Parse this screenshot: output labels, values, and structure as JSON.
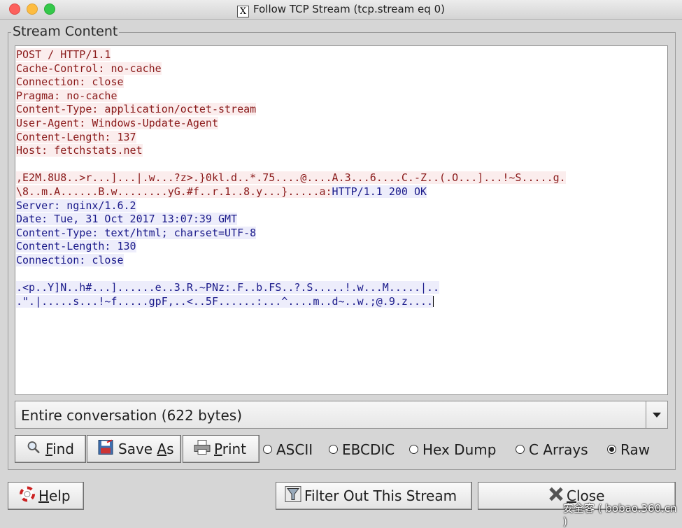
{
  "window": {
    "title": "Follow TCP Stream (tcp.stream eq 0)",
    "app_icon_glyph": "X"
  },
  "group": {
    "legend": "Stream Content"
  },
  "stream": {
    "lines": [
      {
        "text": "POST / HTTP/1.1",
        "side": "client"
      },
      {
        "text": "Cache-Control: no-cache",
        "side": "client"
      },
      {
        "text": "Connection: close",
        "side": "client"
      },
      {
        "text": "Pragma: no-cache",
        "side": "client"
      },
      {
        "text": "Content-Type: application/octet-stream",
        "side": "client"
      },
      {
        "text": "User-Agent: Windows-Update-Agent",
        "side": "client"
      },
      {
        "text": "Content-Length: 137",
        "side": "client"
      },
      {
        "text": "Host: fetchstats.net",
        "side": "client"
      },
      {
        "text": "",
        "side": "client"
      },
      {
        "text": ",E2M.8U8..>r...]...|.w...?z>.}0kl.d..*.75....@....A.3...6....C.-Z..(.O...]...!~S.....g.",
        "side": "client"
      },
      {
        "segments": [
          {
            "text": "\\8..m.A......B.w........yG.#f..r.1..8.y...}.....a:",
            "side": "client"
          },
          {
            "text": "HTTP/1.1 200 OK",
            "side": "server"
          }
        ]
      },
      {
        "text": "Server: nginx/1.6.2",
        "side": "server"
      },
      {
        "text": "Date: Tue, 31 Oct 2017 13:07:39 GMT",
        "side": "server"
      },
      {
        "text": "Content-Type: text/html; charset=UTF-8",
        "side": "server"
      },
      {
        "text": "Content-Length: 130",
        "side": "server"
      },
      {
        "text": "Connection: close",
        "side": "server"
      },
      {
        "text": "",
        "side": "server"
      },
      {
        "text": ".<p..Y]N..h#...]......e..3.R.~PNz:.F..b.FS..?.S.....!.w...M.....|..",
        "side": "server"
      },
      {
        "text": ".\".|.....s...!~f.....gpF,..<..5F......:...^....m..d~..w.;@.9.z....",
        "side": "server",
        "caret": true
      }
    ],
    "client_color": "#8a1a1a",
    "server_color": "#1a1a8a"
  },
  "conversation_select": {
    "selected": "Entire conversation (622 bytes)"
  },
  "actions": {
    "find": {
      "mnemonic": "F",
      "rest": "ind",
      "icon": "magnifier-icon"
    },
    "save_as": {
      "pre": "Save ",
      "mnemonic": "A",
      "rest": "s",
      "icon": "save-icon"
    },
    "print": {
      "mnemonic": "P",
      "rest": "rint",
      "icon": "printer-icon"
    }
  },
  "format": {
    "options": [
      "ASCII",
      "EBCDIC",
      "Hex Dump",
      "C Arrays",
      "Raw"
    ],
    "selected": "Raw"
  },
  "footer": {
    "help": {
      "mnemonic": "H",
      "rest": "elp",
      "icon": "lifebuoy-icon"
    },
    "filter_out": {
      "label": "Filter Out This Stream",
      "icon": "filter-icon"
    },
    "close": {
      "mnemonic": "C",
      "rest": "lose",
      "icon": "close-x-icon"
    }
  },
  "watermark": "安全客 ( bobao.360.cn )"
}
